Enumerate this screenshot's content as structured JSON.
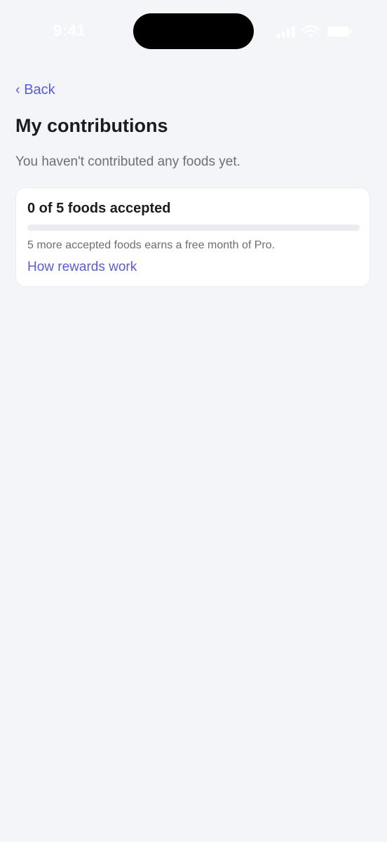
{
  "status_bar": {
    "time": "9:41",
    "icons": [
      "cellular-signal-icon",
      "wifi-icon",
      "battery-icon"
    ]
  },
  "nav": {
    "back_label": "‹ Back"
  },
  "page": {
    "title": "My contributions",
    "subtitle": "You haven't contributed any foods yet."
  },
  "rewards_card": {
    "title": "0 of 5 foods accepted",
    "accepted": 0,
    "goal": 5,
    "progress_fraction": 0,
    "note": "5 more accepted foods earns a free month of Pro.",
    "link_label": "How rewards work"
  },
  "colors": {
    "accent": "#5b5bd6",
    "background": "#f4f5f9",
    "card": "#ffffff",
    "text_primary": "#1c1c20",
    "text_secondary": "#6c6e76",
    "track": "#ebecf1"
  }
}
